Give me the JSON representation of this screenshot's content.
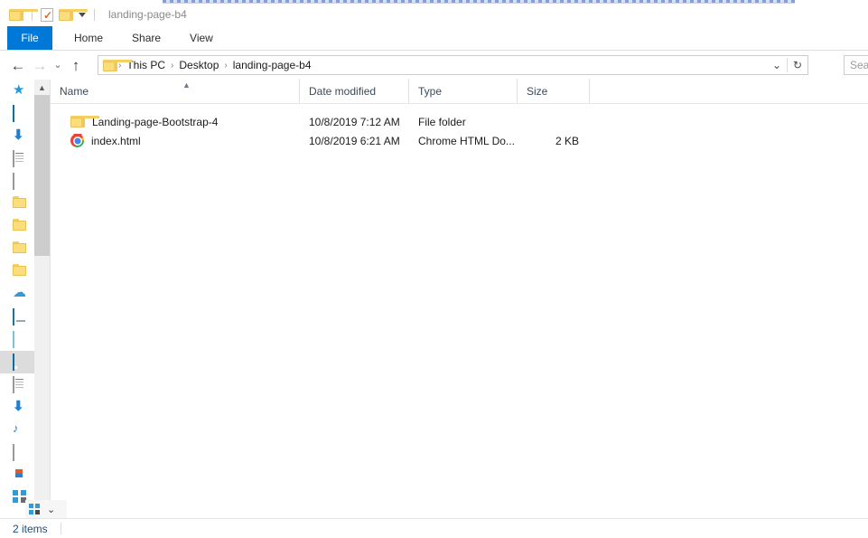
{
  "window": {
    "title": "landing-page-b4"
  },
  "quick_access_toolbar": {
    "folder_icon": "folder-icon",
    "properties_icon": "properties-checkmark-icon",
    "new_folder_icon": "new-folder-icon",
    "customize_icon": "chevron-down-icon"
  },
  "ribbon": {
    "tabs": [
      {
        "label": "File",
        "active": true
      },
      {
        "label": "Home",
        "active": false
      },
      {
        "label": "Share",
        "active": false
      },
      {
        "label": "View",
        "active": false
      }
    ],
    "active_color": "#0078d7"
  },
  "navigation": {
    "back_icon": "arrow-left-icon",
    "forward_icon": "arrow-right-icon",
    "recent_icon": "chevron-down-icon",
    "up_icon": "arrow-up-icon"
  },
  "address_bar": {
    "folder_icon": "folder-icon",
    "crumbs": [
      "This PC",
      "Desktop",
      "landing-page-b4"
    ],
    "separator": "›",
    "dropdown_icon": "chevron-down-icon",
    "refresh_icon": "refresh-icon"
  },
  "search": {
    "value": "",
    "placeholder": "Sea"
  },
  "nav_pane": {
    "items": [
      {
        "icon": "quick-access-star-icon",
        "label": ""
      },
      {
        "icon": "desktop-icon",
        "label": ""
      },
      {
        "icon": "downloads-icon",
        "label": ""
      },
      {
        "icon": "documents-icon",
        "label": ""
      },
      {
        "icon": "pictures-icon",
        "label": ""
      },
      {
        "icon": "folder-icon",
        "label": ""
      },
      {
        "icon": "folder-icon",
        "label": ""
      },
      {
        "icon": "folder-icon",
        "label": ""
      },
      {
        "icon": "folder-icon",
        "label": ""
      },
      {
        "icon": "onedrive-cloud-icon",
        "label": ""
      },
      {
        "icon": "this-pc-icon",
        "label": ""
      },
      {
        "icon": "network-icon",
        "label": ""
      },
      {
        "icon": "desktop-icon",
        "label": "",
        "selected": true
      },
      {
        "icon": "documents-icon",
        "label": ""
      },
      {
        "icon": "downloads-icon",
        "label": ""
      },
      {
        "icon": "music-icon",
        "label": ""
      },
      {
        "icon": "pictures-icon",
        "label": ""
      },
      {
        "icon": "videos-icon",
        "label": ""
      },
      {
        "icon": "local-disk-icon",
        "label": ""
      }
    ],
    "scrollbar": {
      "up_icon": "chevron-up-icon",
      "down_icon": "chevron-down-icon"
    }
  },
  "file_list": {
    "columns": [
      {
        "key": "name",
        "label": "Name",
        "sorted": "asc",
        "sort_icon": "caret-up-icon"
      },
      {
        "key": "date",
        "label": "Date modified"
      },
      {
        "key": "type",
        "label": "Type"
      },
      {
        "key": "size",
        "label": "Size"
      }
    ],
    "rows": [
      {
        "icon": "folder-icon",
        "name": "Landing-page-Bootstrap-4",
        "date": "10/8/2019 7:12 AM",
        "type": "File folder",
        "size": ""
      },
      {
        "icon": "chrome-icon",
        "name": "index.html",
        "date": "10/8/2019 6:21 AM",
        "type": "Chrome HTML Do...",
        "size": "2 KB"
      }
    ]
  },
  "status_bar": {
    "item_count": "2 items",
    "view_tiles_icon": "tiles-view-icon",
    "view_details_icon": "details-view-icon"
  }
}
